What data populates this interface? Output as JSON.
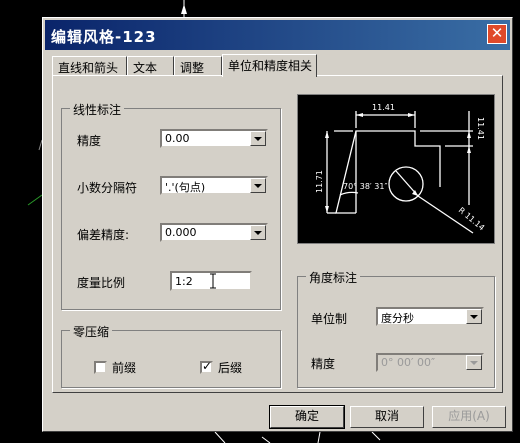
{
  "dialog": {
    "title": "编辑风格-123",
    "close_label": "✕"
  },
  "tabs": [
    {
      "label": "直线和箭头"
    },
    {
      "label": "文本"
    },
    {
      "label": "调整"
    },
    {
      "label": "单位和精度相关",
      "active": true
    }
  ],
  "linear": {
    "title": "线性标注",
    "precision_label": "精度",
    "precision_value": "0.00",
    "decimal_sep_label": "小数分隔符",
    "decimal_sep_value": "'.'(句点)",
    "tolerance_label": "偏差精度:",
    "tolerance_value": "0.000",
    "scale_label": "度量比例",
    "scale_value": "1:2"
  },
  "zero": {
    "title": "零压缩",
    "leading_label": "前缀",
    "leading_checked": false,
    "trailing_label": "后缀",
    "trailing_checked": true
  },
  "angular": {
    "title": "角度标注",
    "unit_label": "单位制",
    "unit_value": "度分秒",
    "precision_label": "精度",
    "precision_value": "0° 00′ 00″"
  },
  "preview": {
    "dim_top": "11.41",
    "dim_right": "11.41",
    "dim_left": "11.71",
    "dim_angle": "70° 38′ 31″",
    "dim_radius": "R 11.14"
  },
  "buttons": {
    "ok": "确定",
    "cancel": "取消",
    "apply": "应用(A)"
  },
  "colors": {
    "titlebar": "#0a246a",
    "dialog_bg": "#d4d0c8",
    "preview_bg": "#000000"
  }
}
